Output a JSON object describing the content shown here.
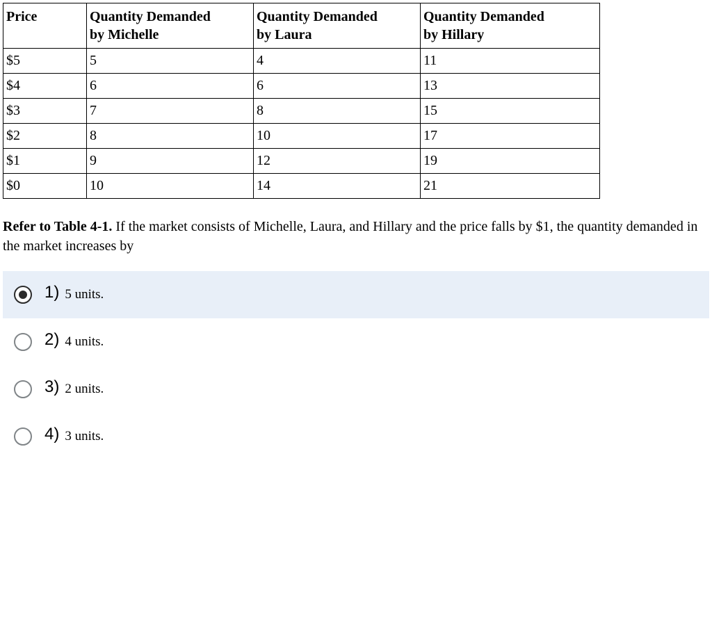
{
  "table": {
    "headers": [
      {
        "title": "Price",
        "sub": ""
      },
      {
        "title": "Quantity Demanded",
        "sub": "by Michelle"
      },
      {
        "title": "Quantity Demanded",
        "sub": "by Laura"
      },
      {
        "title": "Quantity Demanded",
        "sub": "by Hillary"
      }
    ],
    "rows": [
      {
        "price": "$5",
        "michelle": "5",
        "laura": "4",
        "hillary": "11"
      },
      {
        "price": "$4",
        "michelle": "6",
        "laura": "6",
        "hillary": "13"
      },
      {
        "price": "$3",
        "michelle": "7",
        "laura": "8",
        "hillary": "15"
      },
      {
        "price": "$2",
        "michelle": "8",
        "laura": "10",
        "hillary": "17"
      },
      {
        "price": "$1",
        "michelle": "9",
        "laura": "12",
        "hillary": "19"
      },
      {
        "price": "$0",
        "michelle": "10",
        "laura": "14",
        "hillary": "21"
      }
    ]
  },
  "question": {
    "prefix": "Refer to Table 4-1.",
    "body": " If the market consists of Michelle, Laura, and Hillary and the price falls by $1, the quantity demanded in the market increases by"
  },
  "options": [
    {
      "number": "1)",
      "text": "5 units.",
      "selected": true
    },
    {
      "number": "2)",
      "text": "4 units.",
      "selected": false
    },
    {
      "number": "3)",
      "text": "2 units.",
      "selected": false
    },
    {
      "number": "4)",
      "text": "3 units.",
      "selected": false
    }
  ]
}
